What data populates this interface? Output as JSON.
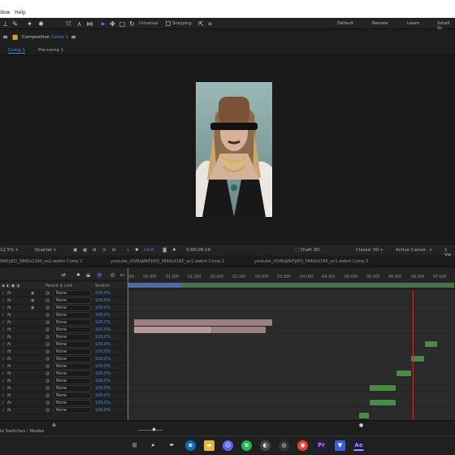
{
  "menubar": {
    "items": [
      "dow",
      "Help"
    ]
  },
  "toolbar": {
    "universal_label": "Universal",
    "snapping_label": "Snapping",
    "workspaces": [
      "Default",
      "Review",
      "Learn",
      "Small Sc"
    ]
  },
  "composition_panel": {
    "title": "Composition",
    "comp_name": "Comp 1",
    "tabs": [
      "Comp 1",
      "Pre-comp 1"
    ]
  },
  "viewer_bar": {
    "zoom": "12.5%",
    "resolution": "Quarter",
    "exposure": "+0.0",
    "timecode": "0:00:06:19",
    "renderer_draft": "Draft 3D",
    "renderer": "Classic 3D",
    "camera": "Active Camer..",
    "views": "1 Vie"
  },
  "timeline_tabs": [
    "WkFpEQ_3840x2160_av1.webm Comp 2",
    "youtube_z5VRqWkFpEQ_3840x2160_av1.webm Comp 1",
    "youtube_z5VRqWkFpEQ_3840x2160_av1.webm Comp 5"
  ],
  "ruler": {
    "ticks": [
      "00f",
      "00:30f",
      "01:00f",
      "01:30f",
      "02:00f",
      "02:30f",
      "03:00f",
      "03:30f",
      "04:00f",
      "04:30f",
      "05:00f",
      "05:30f",
      "06:00f",
      "06:30f",
      "07:00f"
    ]
  },
  "layer_columns": {
    "parent": "Parent & Link",
    "stretch": "Stretch"
  },
  "layers": [
    {
      "parent": "None",
      "stretch": "100.0%"
    },
    {
      "parent": "None",
      "stretch": "100.0%"
    },
    {
      "parent": "None",
      "stretch": "100.0%"
    },
    {
      "parent": "None",
      "stretch": "100.0%"
    },
    {
      "parent": "None",
      "stretch": "100.0%"
    },
    {
      "parent": "None",
      "stretch": "100.0%"
    },
    {
      "parent": "None",
      "stretch": "100.0%"
    },
    {
      "parent": "None",
      "stretch": "100.0%"
    },
    {
      "parent": "None",
      "stretch": "100.0%"
    },
    {
      "parent": "None",
      "stretch": "100.0%"
    },
    {
      "parent": "None",
      "stretch": "100.0%"
    },
    {
      "parent": "None",
      "stretch": "100.0%"
    },
    {
      "parent": "None",
      "stretch": "100.0%"
    },
    {
      "parent": "None",
      "stretch": "100.0%"
    },
    {
      "parent": "None",
      "stretch": "100.0%"
    },
    {
      "parent": "None",
      "stretch": "100.0%"
    },
    {
      "parent": "None",
      "stretch": "100.0%"
    }
  ],
  "footer": {
    "toggle_label": "le Switches / Modes"
  },
  "colors": {
    "accent": "#4e8ad8",
    "playhead": "#c03030",
    "clip_pink": "#b89a9c",
    "clip_green": "#4a8a46"
  },
  "taskbar": {
    "icons": [
      "windows-icon",
      "search-icon",
      "edge-icon",
      "chrome-icon",
      "explorer-icon",
      "discord-icon",
      "spotify-icon",
      "steam-icon",
      "obs-icon",
      "chrome-icon",
      "premiere-icon",
      "vpn-icon",
      "after-effects-icon"
    ],
    "labels": {
      "premiere": "Pr",
      "after_effects": "Ae"
    }
  }
}
